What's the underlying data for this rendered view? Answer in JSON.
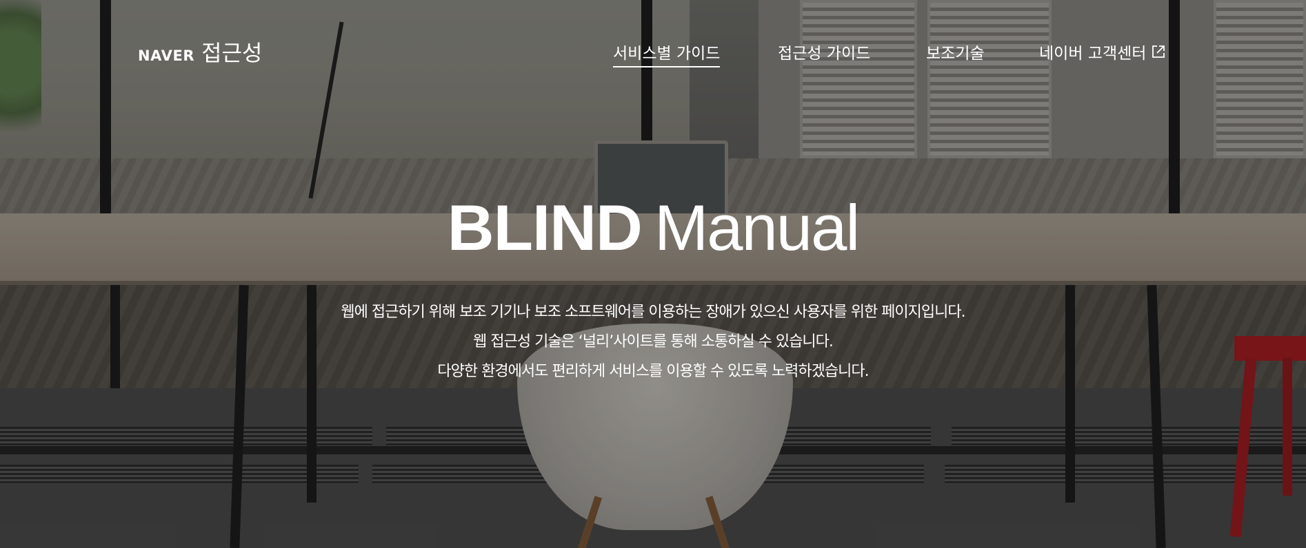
{
  "header": {
    "logo": {
      "brand": "NAVER",
      "service": "접근성"
    },
    "nav": [
      {
        "label": "서비스별 가이드",
        "active": true,
        "external": false
      },
      {
        "label": "접근성 가이드",
        "active": false,
        "external": false
      },
      {
        "label": "보조기술",
        "active": false,
        "external": false
      },
      {
        "label": "네이버 고객센터",
        "active": false,
        "external": true,
        "icon": "external-link-icon"
      }
    ]
  },
  "hero": {
    "title_bold": "BLIND",
    "title_light": "Manual",
    "description": [
      "웹에 접근하기 위해 보조 기기나 보조 소프트웨어를 이용하는 장애가 있으신 사용자를 위한 페이지입니다.",
      "웹 접근성 기술은 ‘널리’사이트를 통해 소통하실 수 있습니다.",
      "다양한 환경에서도 편리하게 서비스를 이용할 수 있도록 노력하겠습니다."
    ]
  },
  "colors": {
    "text": "#ffffff",
    "overlay": "#000000",
    "accent_red_chair": "#a11d22"
  }
}
